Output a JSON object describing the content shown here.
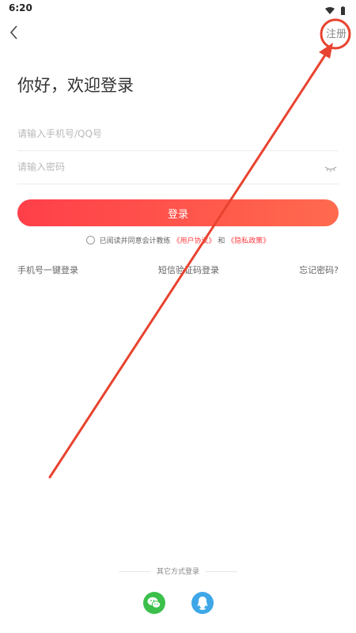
{
  "status_bar": {
    "time": "6:20",
    "icons": [
      "wifi-icon",
      "battery-icon"
    ]
  },
  "nav": {
    "back_icon": "chevron-left-icon",
    "register_label": "注册"
  },
  "title": "你好，欢迎登录",
  "form": {
    "phone_placeholder": "请输入手机号/QQ号",
    "password_placeholder": "请输入密码",
    "login_label": "登录"
  },
  "agreement": {
    "prefix": "已阅读并同意会计教练",
    "user_agreement": "《用户协议》",
    "and": "和",
    "privacy_policy": "《隐私政策》"
  },
  "quick_links": {
    "one_click": "手机号一键登录",
    "sms": "短信验证码登录",
    "forgot": "忘记密码?"
  },
  "other_login": {
    "label": "其它方式登录",
    "options": [
      "wechat-icon",
      "qq-icon"
    ]
  },
  "colors": {
    "accent": "#ff4040",
    "wechat": "#3cc04b",
    "qq": "#3fa7e8",
    "annotation": "#e8432f"
  }
}
